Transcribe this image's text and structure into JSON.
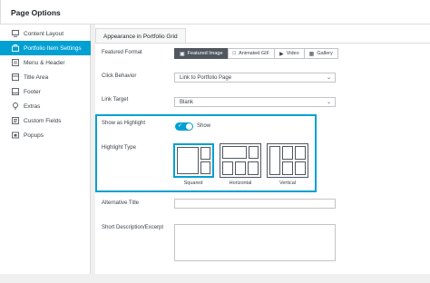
{
  "panel": {
    "title": "Page Options"
  },
  "sidebar": {
    "items": [
      {
        "label": "Content Layout",
        "icon": "monitor-icon",
        "active": false
      },
      {
        "label": "Portfolio Item Settings",
        "icon": "briefcase-icon",
        "active": true
      },
      {
        "label": "Menu & Header",
        "icon": "menu-icon",
        "active": false
      },
      {
        "label": "Title Area",
        "icon": "title-area-icon",
        "active": false
      },
      {
        "label": "Footer",
        "icon": "footer-icon",
        "active": false
      },
      {
        "label": "Extras",
        "icon": "lightbulb-icon",
        "active": false
      },
      {
        "label": "Custom Fields",
        "icon": "custom-fields-icon",
        "active": false
      },
      {
        "label": "Popups",
        "icon": "popup-icon",
        "active": false
      }
    ]
  },
  "content": {
    "section_title": "Appearance in Portfolio Grid",
    "featured_format": {
      "label": "Featured Format",
      "options": [
        {
          "label": "Featured Image",
          "icon": "camera-icon",
          "selected": true
        },
        {
          "label": "Animated GIF",
          "icon": "gif-icon",
          "selected": false
        },
        {
          "label": "Video",
          "icon": "play-icon",
          "selected": false
        },
        {
          "label": "Gallery",
          "icon": "gallery-icon",
          "selected": false
        }
      ]
    },
    "click_behavior": {
      "label": "Click Behavior",
      "value": "Link to Portfolio Page"
    },
    "link_target": {
      "label": "Link Target",
      "value": "Blank"
    },
    "highlight": {
      "toggle_label": "Show as Highlight",
      "toggle_state_text": "Show",
      "toggle_on": true,
      "type_label": "Highlight Type",
      "types": [
        {
          "label": "Squared",
          "selected": true
        },
        {
          "label": "Horizontal",
          "selected": false
        },
        {
          "label": "Vertical",
          "selected": false
        }
      ]
    },
    "alternative_title": {
      "label": "Alternative Title",
      "value": ""
    },
    "short_description": {
      "label": "Short Description/Excerpt",
      "value": ""
    }
  },
  "colors": {
    "accent": "#00a0d2",
    "selected_button": "#50575e"
  }
}
